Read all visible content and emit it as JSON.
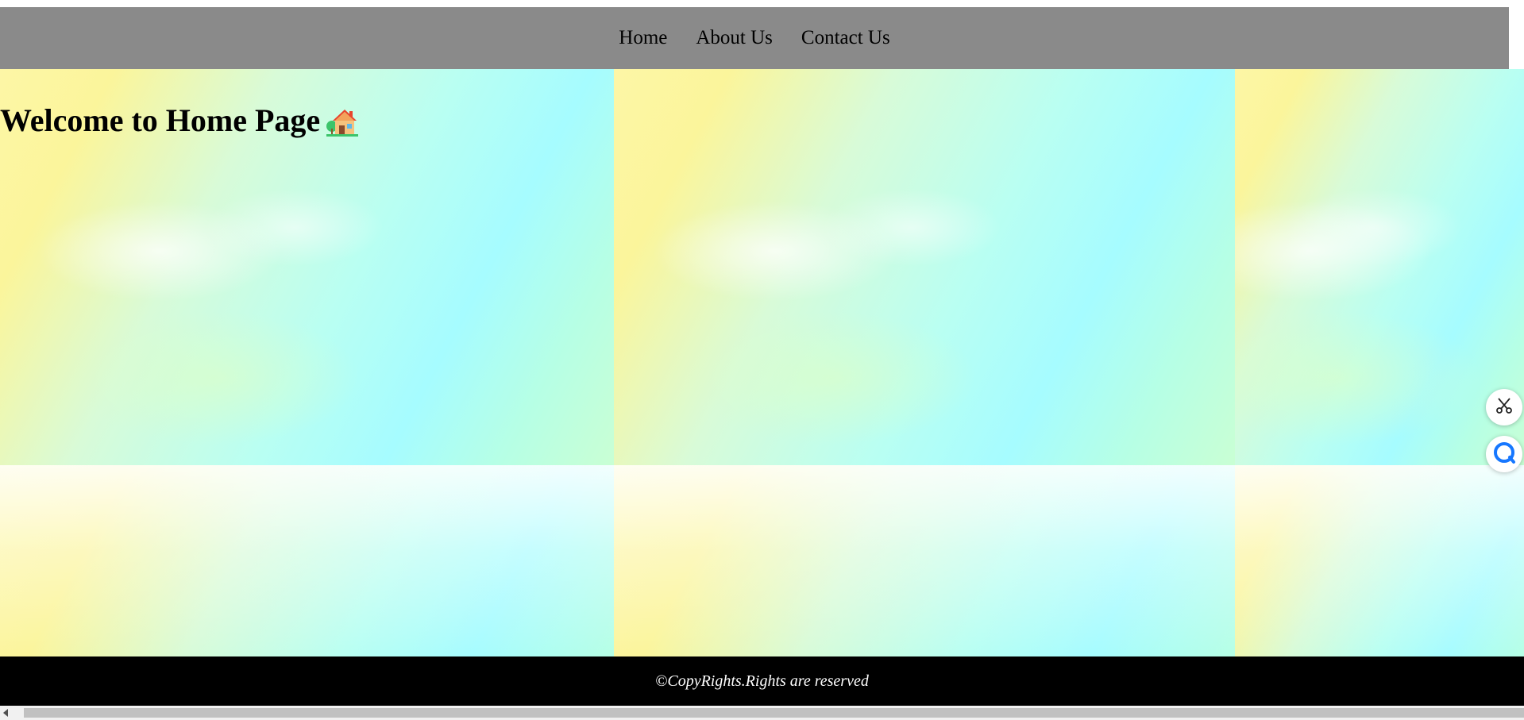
{
  "nav": {
    "items": [
      {
        "label": "Home"
      },
      {
        "label": "About Us"
      },
      {
        "label": "Contact Us"
      }
    ]
  },
  "main": {
    "heading": "Welcome to Home Page",
    "heading_icon": "house-icon"
  },
  "footer": {
    "text": "©CopyRights.Rights are reserved"
  },
  "widgets": {
    "scissors": "scissors-icon",
    "chat": "chat-bubble-icon"
  },
  "colors": {
    "nav_bg": "#8a8a8a",
    "footer_bg": "#000000",
    "footer_text": "#ffffff"
  }
}
